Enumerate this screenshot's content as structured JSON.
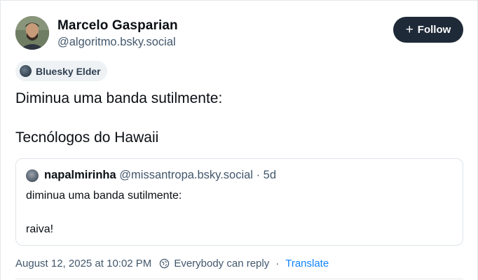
{
  "author": {
    "name": "Marcelo Gasparian",
    "handle": "@algoritmo.bsky.social",
    "avatar": "profile-photo"
  },
  "follow_button": {
    "label": "Follow",
    "icon": "plus-icon"
  },
  "badge": {
    "label": "Bluesky Elder",
    "icon": "avatar-badge-icon"
  },
  "post": {
    "line1": "Diminua uma banda sutilmente:",
    "line2": "Tecnólogos do Hawaii"
  },
  "quote": {
    "author_name": "napalmirinha",
    "author_handle": "@missantropa.bsky.social",
    "separator": "·",
    "age": "5d",
    "line1": "diminua uma banda sutilmente:",
    "line2": "raiva!"
  },
  "meta": {
    "datetime": "August 12, 2025 at 10:02 PM",
    "reply_setting": "Everybody can reply",
    "separator": "·",
    "translate_label": "Translate",
    "reply_icon": "globe-reply-icon"
  },
  "colors": {
    "text": "#0b0f14",
    "muted": "#42576c",
    "follow_bg": "#1f2a38",
    "link": "#1083fe",
    "border": "#dfe4e9"
  }
}
